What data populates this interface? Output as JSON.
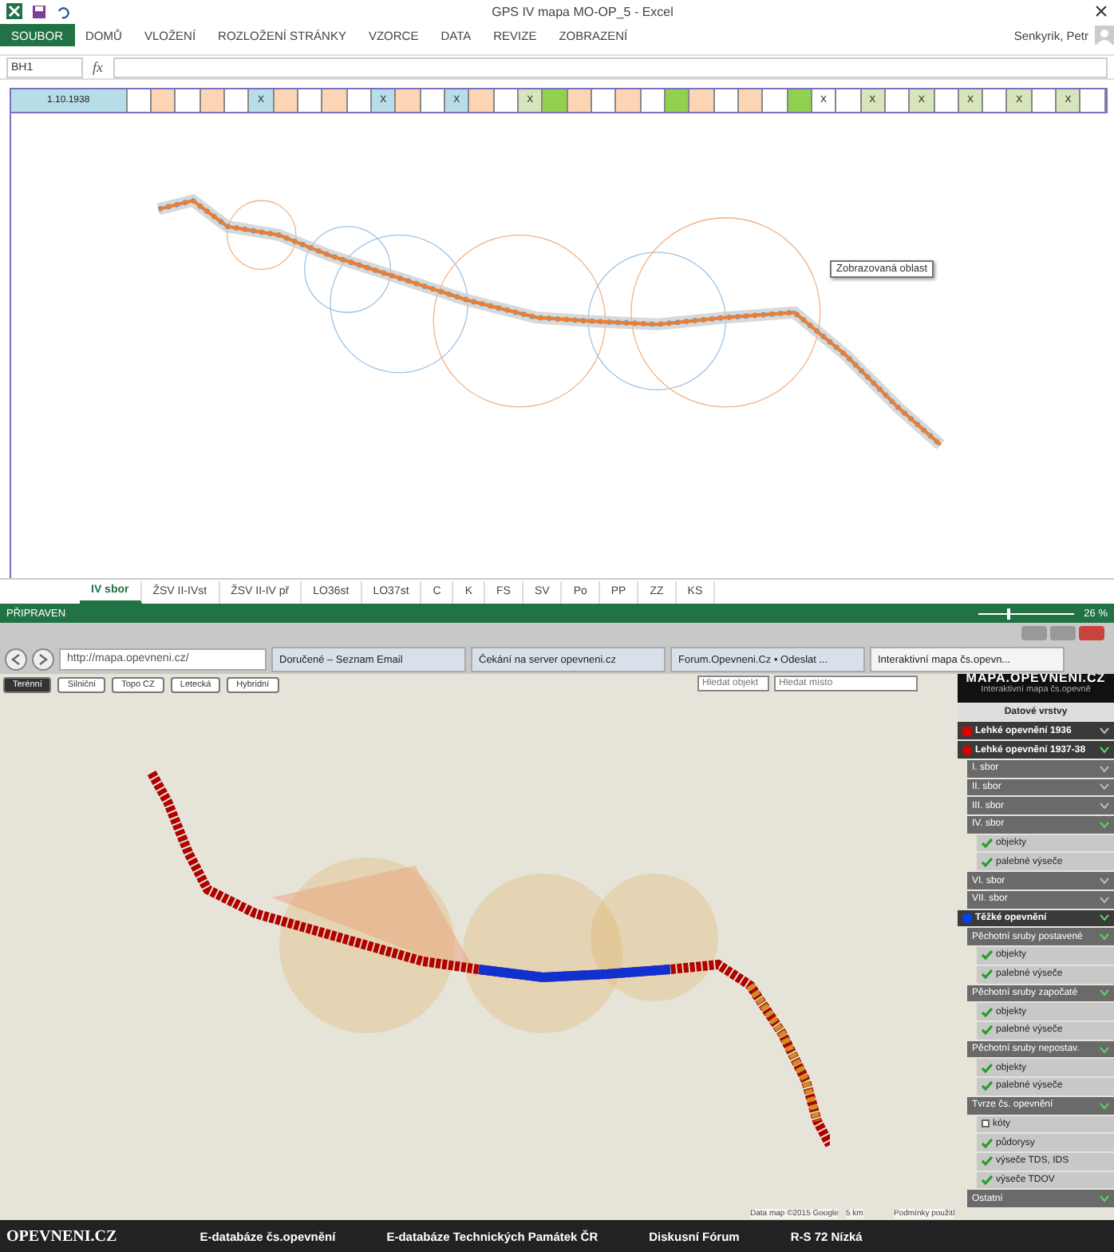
{
  "excel": {
    "title": "GPS IV mapa MO-OP_5 - Excel",
    "ribbon_tabs": [
      {
        "label": "SOUBOR",
        "selected": true
      },
      {
        "label": "DOMŮ",
        "selected": false
      },
      {
        "label": "VLOŽENÍ",
        "selected": false
      },
      {
        "label": "ROZLOŽENÍ STRÁNKY",
        "selected": false
      },
      {
        "label": "VZORCE",
        "selected": false
      },
      {
        "label": "DATA",
        "selected": false
      },
      {
        "label": "REVIZE",
        "selected": false
      },
      {
        "label": "ZOBRAZENÍ",
        "selected": false
      }
    ],
    "user": "Senkyrik, Petr",
    "name_box": "BH1",
    "fx": "fx",
    "header_cells": [
      {
        "text": "1.10.1938",
        "color": "#b7dde8"
      },
      {
        "text": "",
        "color": "#ffffff"
      },
      {
        "text": "",
        "color": "#fcd5b4"
      },
      {
        "text": "",
        "color": "#ffffff"
      },
      {
        "text": "",
        "color": "#fcd5b4"
      },
      {
        "text": "",
        "color": "#ffffff"
      },
      {
        "text": "X",
        "color": "#b7dde8"
      },
      {
        "text": "",
        "color": "#fcd5b4"
      },
      {
        "text": "",
        "color": "#ffffff"
      },
      {
        "text": "",
        "color": "#fcd5b4"
      },
      {
        "text": "",
        "color": "#ffffff"
      },
      {
        "text": "X",
        "color": "#b7dde8"
      },
      {
        "text": "",
        "color": "#fcd5b4"
      },
      {
        "text": "",
        "color": "#ffffff"
      },
      {
        "text": "X",
        "color": "#b7dde8"
      },
      {
        "text": "",
        "color": "#fcd5b4"
      },
      {
        "text": "",
        "color": "#ffffff"
      },
      {
        "text": "X",
        "color": "#d8e4bc"
      },
      {
        "text": "",
        "color": "#92d050"
      },
      {
        "text": "",
        "color": "#fcd5b4"
      },
      {
        "text": "",
        "color": "#ffffff"
      },
      {
        "text": "",
        "color": "#fcd5b4"
      },
      {
        "text": "",
        "color": "#ffffff"
      },
      {
        "text": "",
        "color": "#92d050"
      },
      {
        "text": "",
        "color": "#fcd5b4"
      },
      {
        "text": "",
        "color": "#ffffff"
      },
      {
        "text": "",
        "color": "#fcd5b4"
      },
      {
        "text": "",
        "color": "#ffffff"
      },
      {
        "text": "",
        "color": "#92d050"
      },
      {
        "text": "X",
        "color": "#ffffff"
      },
      {
        "text": "",
        "color": "#ffffff"
      },
      {
        "text": "X",
        "color": "#d8e4bc"
      },
      {
        "text": "",
        "color": "#ffffff"
      },
      {
        "text": "X",
        "color": "#d8e4bc"
      },
      {
        "text": "",
        "color": "#ffffff"
      },
      {
        "text": "X",
        "color": "#d8e4bc"
      },
      {
        "text": "",
        "color": "#ffffff"
      },
      {
        "text": "X",
        "color": "#d8e4bc"
      },
      {
        "text": "",
        "color": "#ffffff"
      },
      {
        "text": "X",
        "color": "#d8e4bc"
      },
      {
        "text": "",
        "color": "#ffffff"
      }
    ],
    "chart_tooltip": "Zobrazovaná oblast",
    "sheet_tabs": [
      {
        "label": "IV sbor",
        "selected": true
      },
      {
        "label": "ŽSV II-IVst",
        "selected": false
      },
      {
        "label": "ŽSV II-IV př",
        "selected": false
      },
      {
        "label": "LO36st",
        "selected": false
      },
      {
        "label": "LO37st",
        "selected": false
      },
      {
        "label": "C",
        "selected": false
      },
      {
        "label": "K",
        "selected": false
      },
      {
        "label": "FS",
        "selected": false
      },
      {
        "label": "SV",
        "selected": false
      },
      {
        "label": "Po",
        "selected": false
      },
      {
        "label": "PP",
        "selected": false
      },
      {
        "label": "ZZ",
        "selected": false
      },
      {
        "label": "KS",
        "selected": false
      }
    ],
    "status": "PŘIPRAVEN",
    "zoom": {
      "level": 0.3,
      "reading": "26 %"
    }
  },
  "browser": {
    "address": "http://mapa.opevneni.cz/",
    "tabs": [
      {
        "label": "Doručené – Seznam Email",
        "selected": false
      },
      {
        "label": "Čekání na server opevneni.cz",
        "selected": false
      },
      {
        "label": "Forum.Opevneni.Cz • Odeslat ...",
        "selected": false
      },
      {
        "label": "Interaktivní mapa čs.opevn...",
        "selected": true
      }
    ],
    "map_types": [
      {
        "label": "Terénní",
        "selected": true
      },
      {
        "label": "Silniční",
        "selected": false
      },
      {
        "label": "Topo CZ",
        "selected": false
      },
      {
        "label": "Letecká",
        "selected": false
      },
      {
        "label": "Hybridní",
        "selected": false
      }
    ],
    "search": [
      {
        "placeholder": "Hledat objekt"
      },
      {
        "placeholder": "Hledat místo"
      }
    ],
    "logo": "MAPA.OPEVNENI.CZ",
    "logo_sub": "Interaktivní mapa čs.opevně",
    "attribution": [
      "Data map ©2015 Google",
      "5 km",
      "Podmínky použití"
    ],
    "panel": [
      {
        "kind": "title",
        "label": "Datové vrstvy"
      },
      {
        "kind": "squarelayer",
        "label": "Lehké opevnění 1936",
        "color": "#e00000",
        "expanded": false
      },
      {
        "kind": "dotlayer",
        "label": "Lehké opevnění 1937-38",
        "color": "#e00000",
        "expanded": true
      },
      {
        "kind": "group",
        "label": "I. sbor",
        "expanded": false
      },
      {
        "kind": "group",
        "label": "II. sbor",
        "expanded": false
      },
      {
        "kind": "group",
        "label": "III. sbor",
        "expanded": false
      },
      {
        "kind": "group",
        "label": "IV. sbor",
        "expanded": true
      },
      {
        "kind": "check",
        "label": "objekty",
        "checked": true
      },
      {
        "kind": "check",
        "label": "palebné výseče",
        "checked": true
      },
      {
        "kind": "group",
        "label": "VI. sbor",
        "expanded": false
      },
      {
        "kind": "group",
        "label": "VII. sbor",
        "expanded": false
      },
      {
        "kind": "dotlayer",
        "label": "Těžké opevnění",
        "color": "#0040ff",
        "expanded": true
      },
      {
        "kind": "group",
        "label": "Pěchotní sruby postavené",
        "expanded": true
      },
      {
        "kind": "check",
        "label": "objekty",
        "checked": true
      },
      {
        "kind": "check",
        "label": "palebné výseče",
        "checked": true
      },
      {
        "kind": "group",
        "label": "Pěchotní sruby započaté",
        "expanded": true
      },
      {
        "kind": "check",
        "label": "objekty",
        "checked": true
      },
      {
        "kind": "check",
        "label": "palebné výseče",
        "checked": true
      },
      {
        "kind": "group",
        "label": "Pěchotní sruby nepostav.",
        "expanded": true
      },
      {
        "kind": "check",
        "label": "objekty",
        "checked": true
      },
      {
        "kind": "check",
        "label": "palebné výseče",
        "checked": true
      },
      {
        "kind": "group",
        "label": "Tvrze čs. opevnění",
        "expanded": true
      },
      {
        "kind": "check",
        "label": "kóty",
        "checked": false
      },
      {
        "kind": "check",
        "label": "půdorysy",
        "checked": true
      },
      {
        "kind": "check",
        "label": "výseče TDS, IDS",
        "checked": true
      },
      {
        "kind": "check",
        "label": "výseče TDOV",
        "checked": true
      },
      {
        "kind": "group",
        "label": "Ostatní",
        "expanded": true
      }
    ],
    "footer": {
      "brand": "OPEVNENI.CZ",
      "links": [
        "E-databáze čs.opevnění",
        "E-databáze Technických Památek ČR",
        "Diskusní Fórum",
        "R-S 72 Nízká"
      ]
    }
  }
}
